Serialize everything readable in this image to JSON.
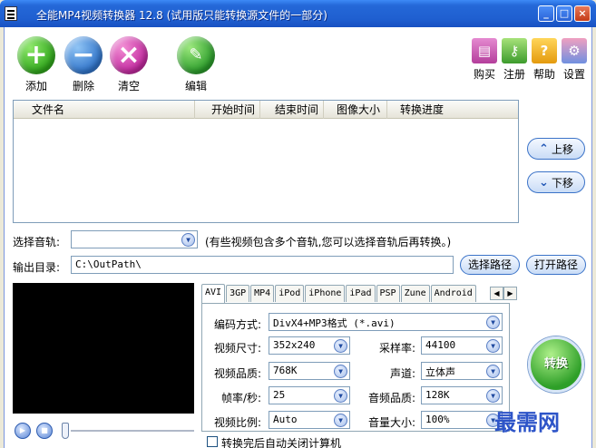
{
  "window": {
    "title": "全能MP4视频转换器 12.8 (试用版只能转换源文件的一部分)",
    "minimize": "_",
    "maximize": "□",
    "close": "×"
  },
  "toolbar": {
    "add": "添加",
    "delete": "删除",
    "clear": "清空",
    "edit": "编辑",
    "buy": "购买",
    "register": "注册",
    "help": "帮助",
    "settings": "设置"
  },
  "file_list": {
    "columns": [
      "文件名",
      "开始时间",
      "结束时间",
      "图像大小",
      "转换进度"
    ],
    "rows": []
  },
  "side_buttons": {
    "move_up": "上移",
    "move_down": "下移"
  },
  "audio_track": {
    "label": "选择音轨:",
    "value": "",
    "hint": "(有些视频包含多个音轨,您可以选择音轨后再转换。)"
  },
  "output": {
    "label": "输出目录:",
    "path": "C:\\OutPath\\",
    "choose_path": "选择路径",
    "open_path": "打开路径"
  },
  "tabs": [
    "AVI",
    "3GP",
    "MP4",
    "iPod",
    "iPhone",
    "iPad",
    "PSP",
    "Zune",
    "Android"
  ],
  "settings": {
    "encoding_label": "编码方式:",
    "encoding_value": "DivX4+MP3格式 (*.avi)",
    "video_size_label": "视频尺寸:",
    "video_size_value": "352x240",
    "sample_rate_label": "采样率:",
    "sample_rate_value": "44100",
    "video_quality_label": "视频品质:",
    "video_quality_value": "768K",
    "channel_label": "声道:",
    "channel_value": "立体声",
    "fps_label": "帧率/秒:",
    "fps_value": "25",
    "audio_quality_label": "音频品质:",
    "audio_quality_value": "128K",
    "aspect_label": "视频比例:",
    "aspect_value": "Auto",
    "volume_label": "音量大小:",
    "volume_value": "100%"
  },
  "convert": "转换",
  "auto_shutdown": "转换完后自动关闭计算机",
  "watermark": "最需网"
}
